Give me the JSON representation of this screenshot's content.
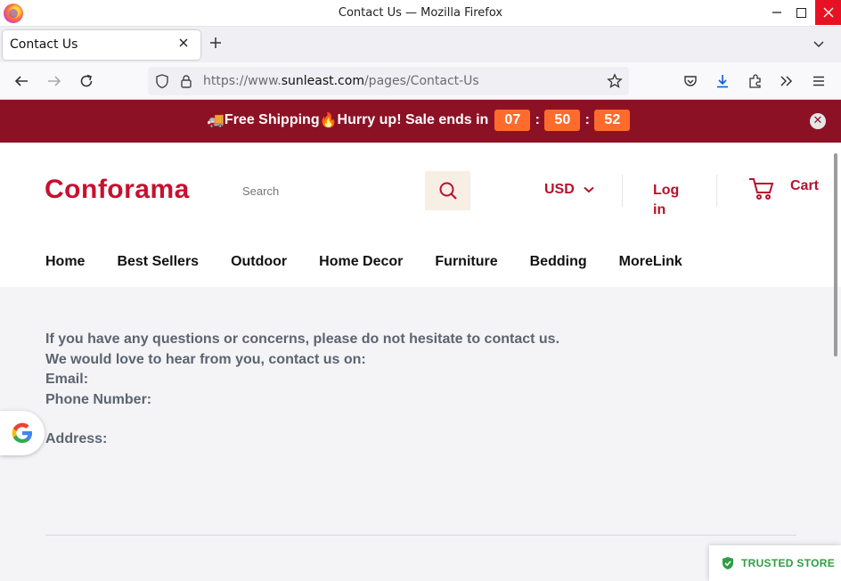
{
  "window": {
    "title": "Contact Us — Mozilla Firefox"
  },
  "tab": {
    "title": "Contact Us"
  },
  "url": {
    "prefix": "https://www.",
    "domain": "sunleast.com",
    "path": "/pages/Contact-Us"
  },
  "banner": {
    "truck_emoji": "🚚",
    "text1": "Free Shipping",
    "fire_emoji": "🔥",
    "text2": "Hurry up! Sale ends in",
    "hours": "07",
    "minutes": "50",
    "seconds": "52",
    "sep": ":",
    "color": "#8d1125"
  },
  "store": {
    "logo": "Conforama",
    "search_placeholder": "Search",
    "currency": "USD",
    "login": "Log in",
    "cart": "Cart",
    "menu": [
      "Home",
      "Best Sellers",
      "Outdoor",
      "Home Decor",
      "Furniture",
      "Bedding",
      "MoreLink"
    ]
  },
  "content": {
    "line1": "If you have any questions or concerns, please do not hesitate to contact us.",
    "line2": "We would love to hear from you, contact us on:",
    "email_label": "Email:",
    "phone_label": "Phone Number:",
    "address_label": "Address:"
  },
  "trusted": "TRUSTED STORE",
  "icons": {
    "back": "back-arrow-icon",
    "forward": "forward-arrow-icon",
    "reload": "reload-icon",
    "shield": "tracking-shield-icon",
    "lock": "lock-icon",
    "star": "bookmark-star-icon",
    "pocket": "pocket-icon",
    "download": "download-icon",
    "extensions": "extensions-icon",
    "overflow": "overflow-chevron-icon",
    "menu": "hamburger-menu-icon"
  }
}
